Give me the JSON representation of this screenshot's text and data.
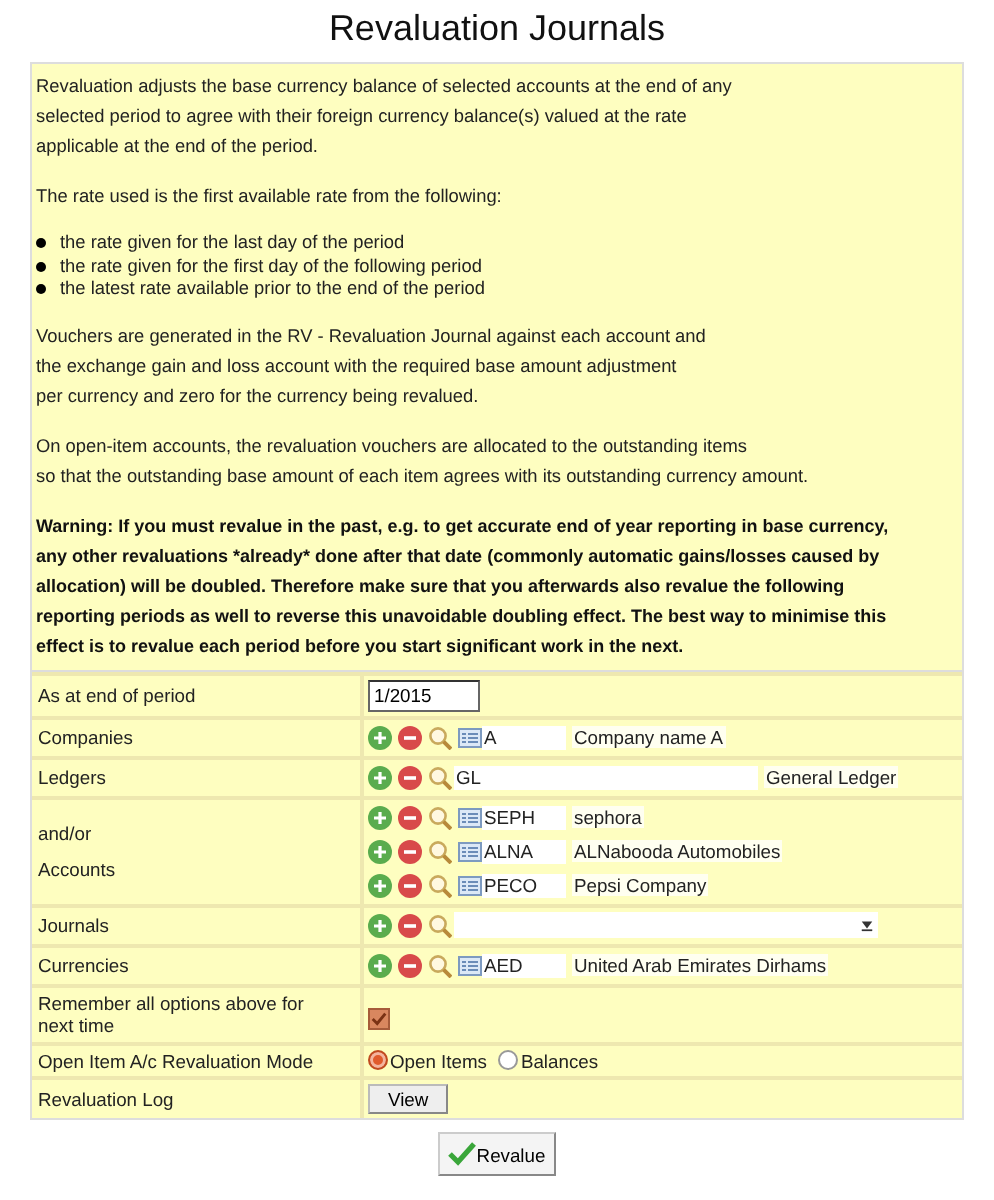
{
  "title": "Revaluation Journals",
  "intro": [
    {
      "kind": "text",
      "lines": [
        "Revaluation adjusts the base currency balance of selected accounts at the end of any",
        "selected period to agree with their foreign currency balance(s) valued at the rate",
        "applicable at the end of the period."
      ]
    },
    {
      "kind": "text",
      "lines": [
        "The rate used is the first available rate from the following:"
      ]
    },
    {
      "kind": "list",
      "lines": [
        "the rate given for the last day of the period",
        "the rate given for the first day of the following period",
        "the latest rate available prior to the end of the period"
      ]
    },
    {
      "kind": "text",
      "lines": [
        "Vouchers are generated in the RV - Revaluation Journal against each account and",
        "the exchange gain and loss account with the required base amount adjustment",
        "per currency and zero for the currency being revalued."
      ]
    },
    {
      "kind": "text",
      "lines": [
        "On open-item accounts, the revaluation vouchers are allocated to the outstanding items",
        "so that the outstanding base amount of each item agrees with its outstanding currency amount."
      ]
    },
    {
      "kind": "warning",
      "lines": [
        "Warning: If you must revalue in the past, e.g. to get accurate end of year reporting in base currency, any other revaluations *already* done after that date (commonly automatic gains/losses caused by allocation) will be doubled. Therefore make sure that you afterwards also revalue the following  reporting periods as well to reverse this unavoidable doubling effect. The best way to minimise this effect is to revalue each period before you start significant work in the next."
      ]
    }
  ],
  "form": [
    {
      "kind": "text_input",
      "label": [
        "As at end of period"
      ],
      "value": "1/2015"
    },
    {
      "kind": "selector",
      "label": [
        "Companies"
      ],
      "entries": [
        {
          "code": "A",
          "name": "Company name A",
          "browse": true
        }
      ]
    },
    {
      "kind": "selector",
      "label": [
        "Ledgers"
      ],
      "entries": [
        {
          "code": "GL",
          "name": "General Ledger",
          "browse": false
        }
      ]
    },
    {
      "kind": "selector",
      "label": [
        "and/or",
        "Accounts"
      ],
      "entries": [
        {
          "code": "SEPH",
          "name": "sephora",
          "browse": true
        },
        {
          "code": "ALNA",
          "name": "ALNabooda Automobiles",
          "browse": true
        },
        {
          "code": "PECO",
          "name": "Pepsi Company",
          "browse": true
        }
      ]
    },
    {
      "kind": "dropdown",
      "label": [
        "Journals"
      ]
    },
    {
      "kind": "selector",
      "label": [
        "Currencies"
      ],
      "entries": [
        {
          "code": "AED",
          "name": "United Arab Emirates Dirhams",
          "browse": true
        }
      ]
    },
    {
      "kind": "checkbox",
      "label": [
        "Remember all options above for next time"
      ],
      "checked": true
    },
    {
      "kind": "radio",
      "label": [
        "Open Item A/c Revaluation Mode"
      ],
      "options": [
        {
          "label": "Open Items",
          "selected": true
        },
        {
          "label": "Balances",
          "selected": false
        }
      ]
    },
    {
      "kind": "button",
      "label": [
        "Revaluation Log"
      ],
      "button": "View"
    }
  ],
  "submit": "Revalue"
}
